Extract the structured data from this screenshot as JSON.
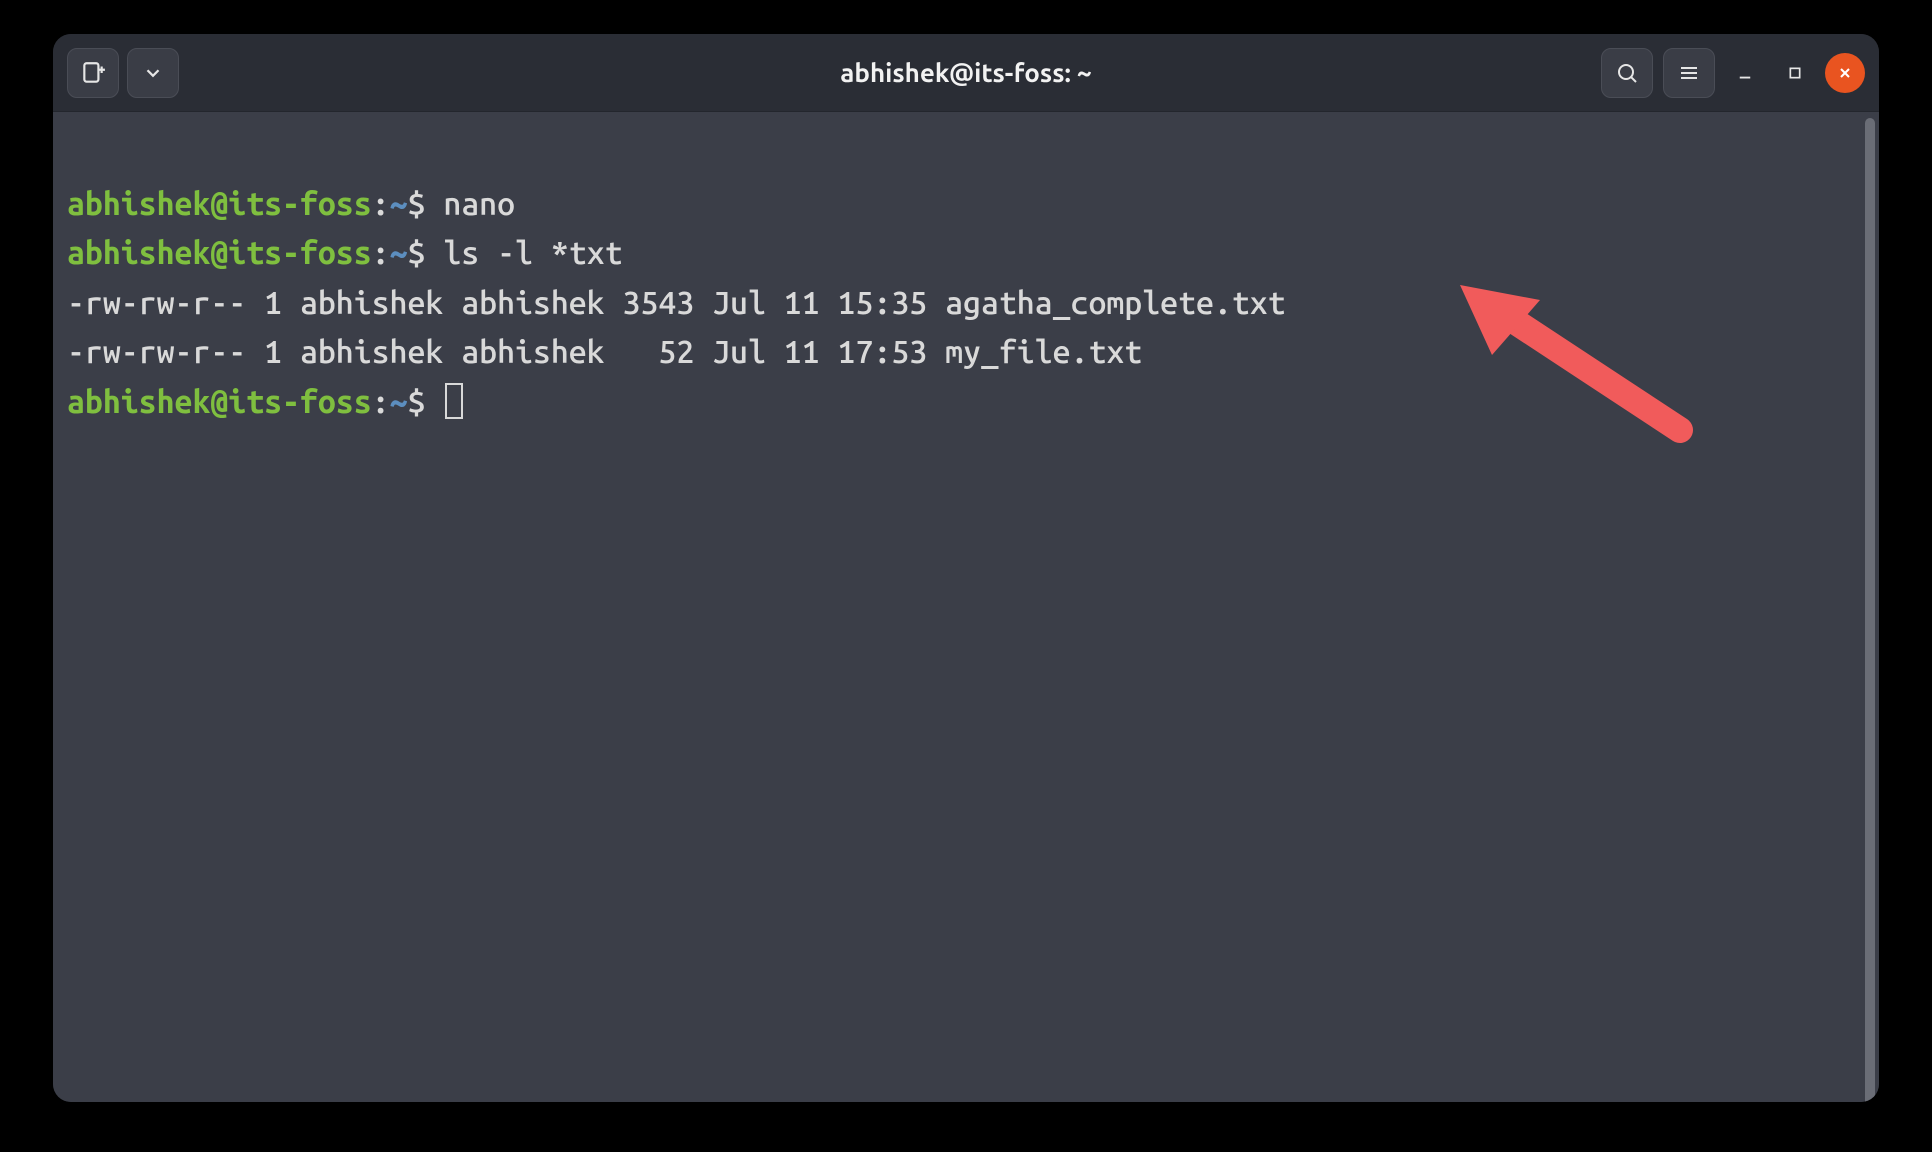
{
  "window": {
    "title": "abhishek@its-foss: ~"
  },
  "prompt": {
    "user_host": "abhishek@its-foss",
    "separator": ":",
    "path": "~",
    "symbol": "$"
  },
  "lines": {
    "cmd1": "nano",
    "cmd2": "ls -l *txt",
    "out1": "-rw-rw-r-- 1 abhishek abhishek 3543 Jul 11 15:35 agatha_complete.txt",
    "out2": "-rw-rw-r-- 1 abhishek abhishek   52 Jul 11 17:53 my_file.txt"
  },
  "ls_output": [
    {
      "perms": "-rw-rw-r--",
      "links": 1,
      "owner": "abhishek",
      "group": "abhishek",
      "size": 3543,
      "month": "Jul",
      "day": 11,
      "time": "15:35",
      "name": "agatha_complete.txt"
    },
    {
      "perms": "-rw-rw-r--",
      "links": 1,
      "owner": "abhishek",
      "group": "abhishek",
      "size": 52,
      "month": "Jul",
      "day": 11,
      "time": "17:53",
      "name": "my_file.txt"
    }
  ],
  "annotation": {
    "color": "#f15b5b",
    "points_to": "my_file.txt"
  }
}
